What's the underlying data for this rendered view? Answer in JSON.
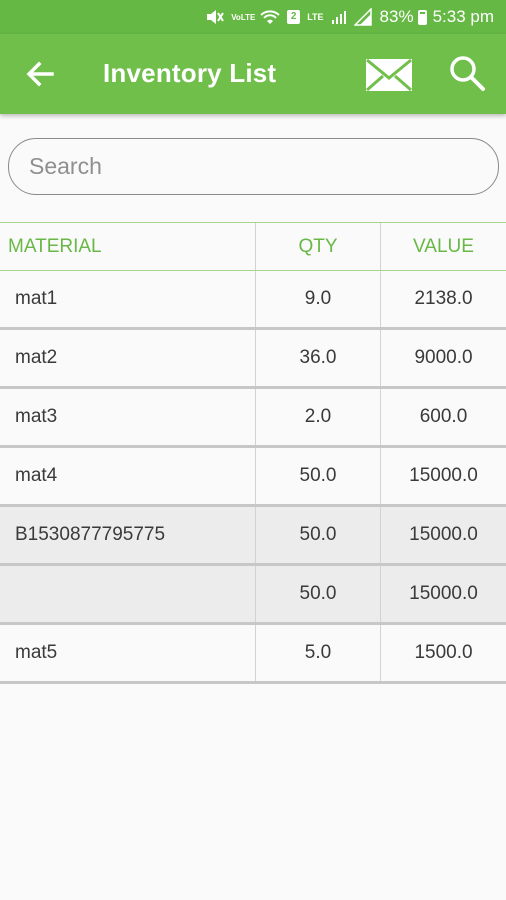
{
  "status_bar": {
    "volte": "VoLTE",
    "lte": "LTE",
    "sim": "2",
    "battery": "83%",
    "time": "5:33 pm"
  },
  "app_bar": {
    "title": "Inventory List",
    "icons": [
      "arrow-back-icon",
      "mail-icon",
      "search-icon"
    ],
    "color": "#71bf4b"
  },
  "search": {
    "placeholder": "Search",
    "value": ""
  },
  "table": {
    "columns": [
      "MATERIAL",
      "QTY",
      "VALUE"
    ],
    "rows": [
      {
        "material": "mat1",
        "qty": "9.0",
        "value": "2138.0",
        "shaded": false
      },
      {
        "material": "mat2",
        "qty": "36.0",
        "value": "9000.0",
        "shaded": false
      },
      {
        "material": "mat3",
        "qty": "2.0",
        "value": "600.0",
        "shaded": false
      },
      {
        "material": "mat4",
        "qty": "50.0",
        "value": "15000.0",
        "shaded": false
      },
      {
        "material": "B1530877795775",
        "qty": "50.0",
        "value": "15000.0",
        "shaded": true
      },
      {
        "material": "",
        "qty": "50.0",
        "value": "15000.0",
        "shaded": true
      },
      {
        "material": "mat5",
        "qty": "5.0",
        "value": "1500.0",
        "shaded": false
      }
    ]
  }
}
